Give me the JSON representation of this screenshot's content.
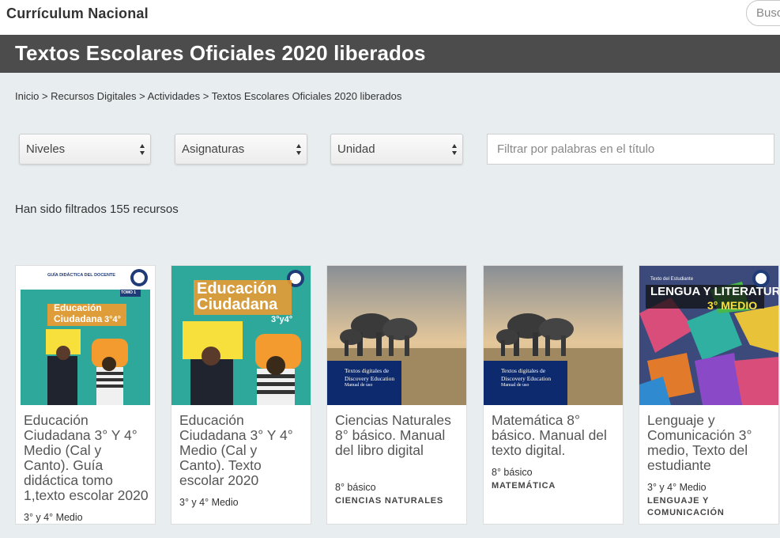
{
  "header": {
    "brand": "Currículum Nacional",
    "search_placeholder": "Buscar"
  },
  "hero": {
    "title": "Textos Escolares Oficiales 2020 liberados"
  },
  "breadcrumb": "Inicio > Recursos Digitales > Actividades > Textos Escolares Oficiales 2020 liberados",
  "filters": {
    "levels": "Niveles",
    "subjects": "Asignaturas",
    "unit": "Unidad",
    "title_placeholder": "Filtrar por palabras en el título"
  },
  "results_count": "Han sido filtrados 155 recursos",
  "cards": [
    {
      "title": "Educación Ciudadana 3° Y 4° Medio (Cal y Canto). Guía didáctica tomo 1,texto escolar 2020",
      "level": "3° y 4° Medio",
      "subject": "",
      "cover_text": {
        "header": "GUÍA DIDÁCTICA DEL DOCENTE",
        "title_a": "Educación",
        "title_b": "Ciudadana",
        "grade": "3°4°",
        "tomo": "TOMO 1"
      }
    },
    {
      "title": "Educación Ciudadana 3° Y 4° Medio (Cal y Canto). Texto escolar 2020",
      "level": "3° y 4° Medio",
      "subject": "",
      "cover_text": {
        "title_a": "Educación",
        "title_b": "Ciudadana",
        "grade": "3°y4°"
      }
    },
    {
      "title": "Ciencias Naturales 8° básico. Manual del libro digital",
      "level": "8° básico",
      "subject": "CIENCIAS NATURALES",
      "cover_text": {
        "line1": "Textos digitales de",
        "line2": "Discovery Education",
        "line3": "Manual de uso"
      }
    },
    {
      "title": "Matemática 8° básico. Manual del texto digital.",
      "level": "8° básico",
      "subject": "MATEMÁTICA",
      "cover_text": {
        "line1": "Textos digitales de",
        "line2": "Discovery Education",
        "line3": "Manual de uso"
      }
    },
    {
      "title": "Lenguaje y Comunicación 3° medio, Texto del estudiante",
      "level": "3° y 4° Medio",
      "subject": "LENGUAJE Y COMUNICACIÓN",
      "cover_text": {
        "top": "Texto del Estudiante",
        "title": "LENGUA Y LITERATURA",
        "grade": "3° MEDIO"
      }
    }
  ],
  "colors": {
    "hero_bg": "#4c4c4c",
    "page_bg": "#e8edf0",
    "teal_cover": "#2fa89c",
    "navy_panel": "#0d2a6e",
    "yellow_sign": "#f7e03c",
    "orange_sign": "#f39b2f"
  }
}
